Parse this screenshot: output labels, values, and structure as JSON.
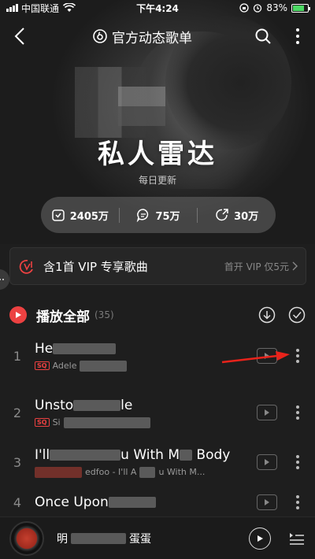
{
  "status_bar": {
    "carrier": "中国联通",
    "time": "下午4:24",
    "battery": "83%"
  },
  "header": {
    "title": "官方动态歌单"
  },
  "playlist": {
    "name": "私人雷达",
    "subtitle": "每日更新"
  },
  "stats": {
    "collect": "2405万",
    "comments": "75万",
    "shares": "30万"
  },
  "vip": {
    "label": "含1首 VIP 专享歌曲",
    "action": "首开 VIP 仅5元"
  },
  "play_all": {
    "label": "播放全部",
    "count": "(35)"
  },
  "songs": [
    {
      "index": "1",
      "title": "He",
      "artist": "Adele",
      "meta_tail": "",
      "sq": "SQ"
    },
    {
      "index": "2",
      "title": "Unsto",
      "title_tail": "le",
      "artist": "Si",
      "sq": "SQ"
    },
    {
      "index": "3",
      "title": "I'll",
      "title_tail": "u With M",
      "title_tail2": "Body",
      "artist": "edfoo - I'll A",
      "meta_tail": "u With M...",
      "sq": ""
    },
    {
      "index": "4",
      "title": "Once Upon",
      "artist": "",
      "sq": ""
    }
  ],
  "player": {
    "track_prefix": "明",
    "track_suffix": "蛋蛋"
  },
  "colors": {
    "accent": "#ec4141",
    "background": "#1e1e1e"
  }
}
